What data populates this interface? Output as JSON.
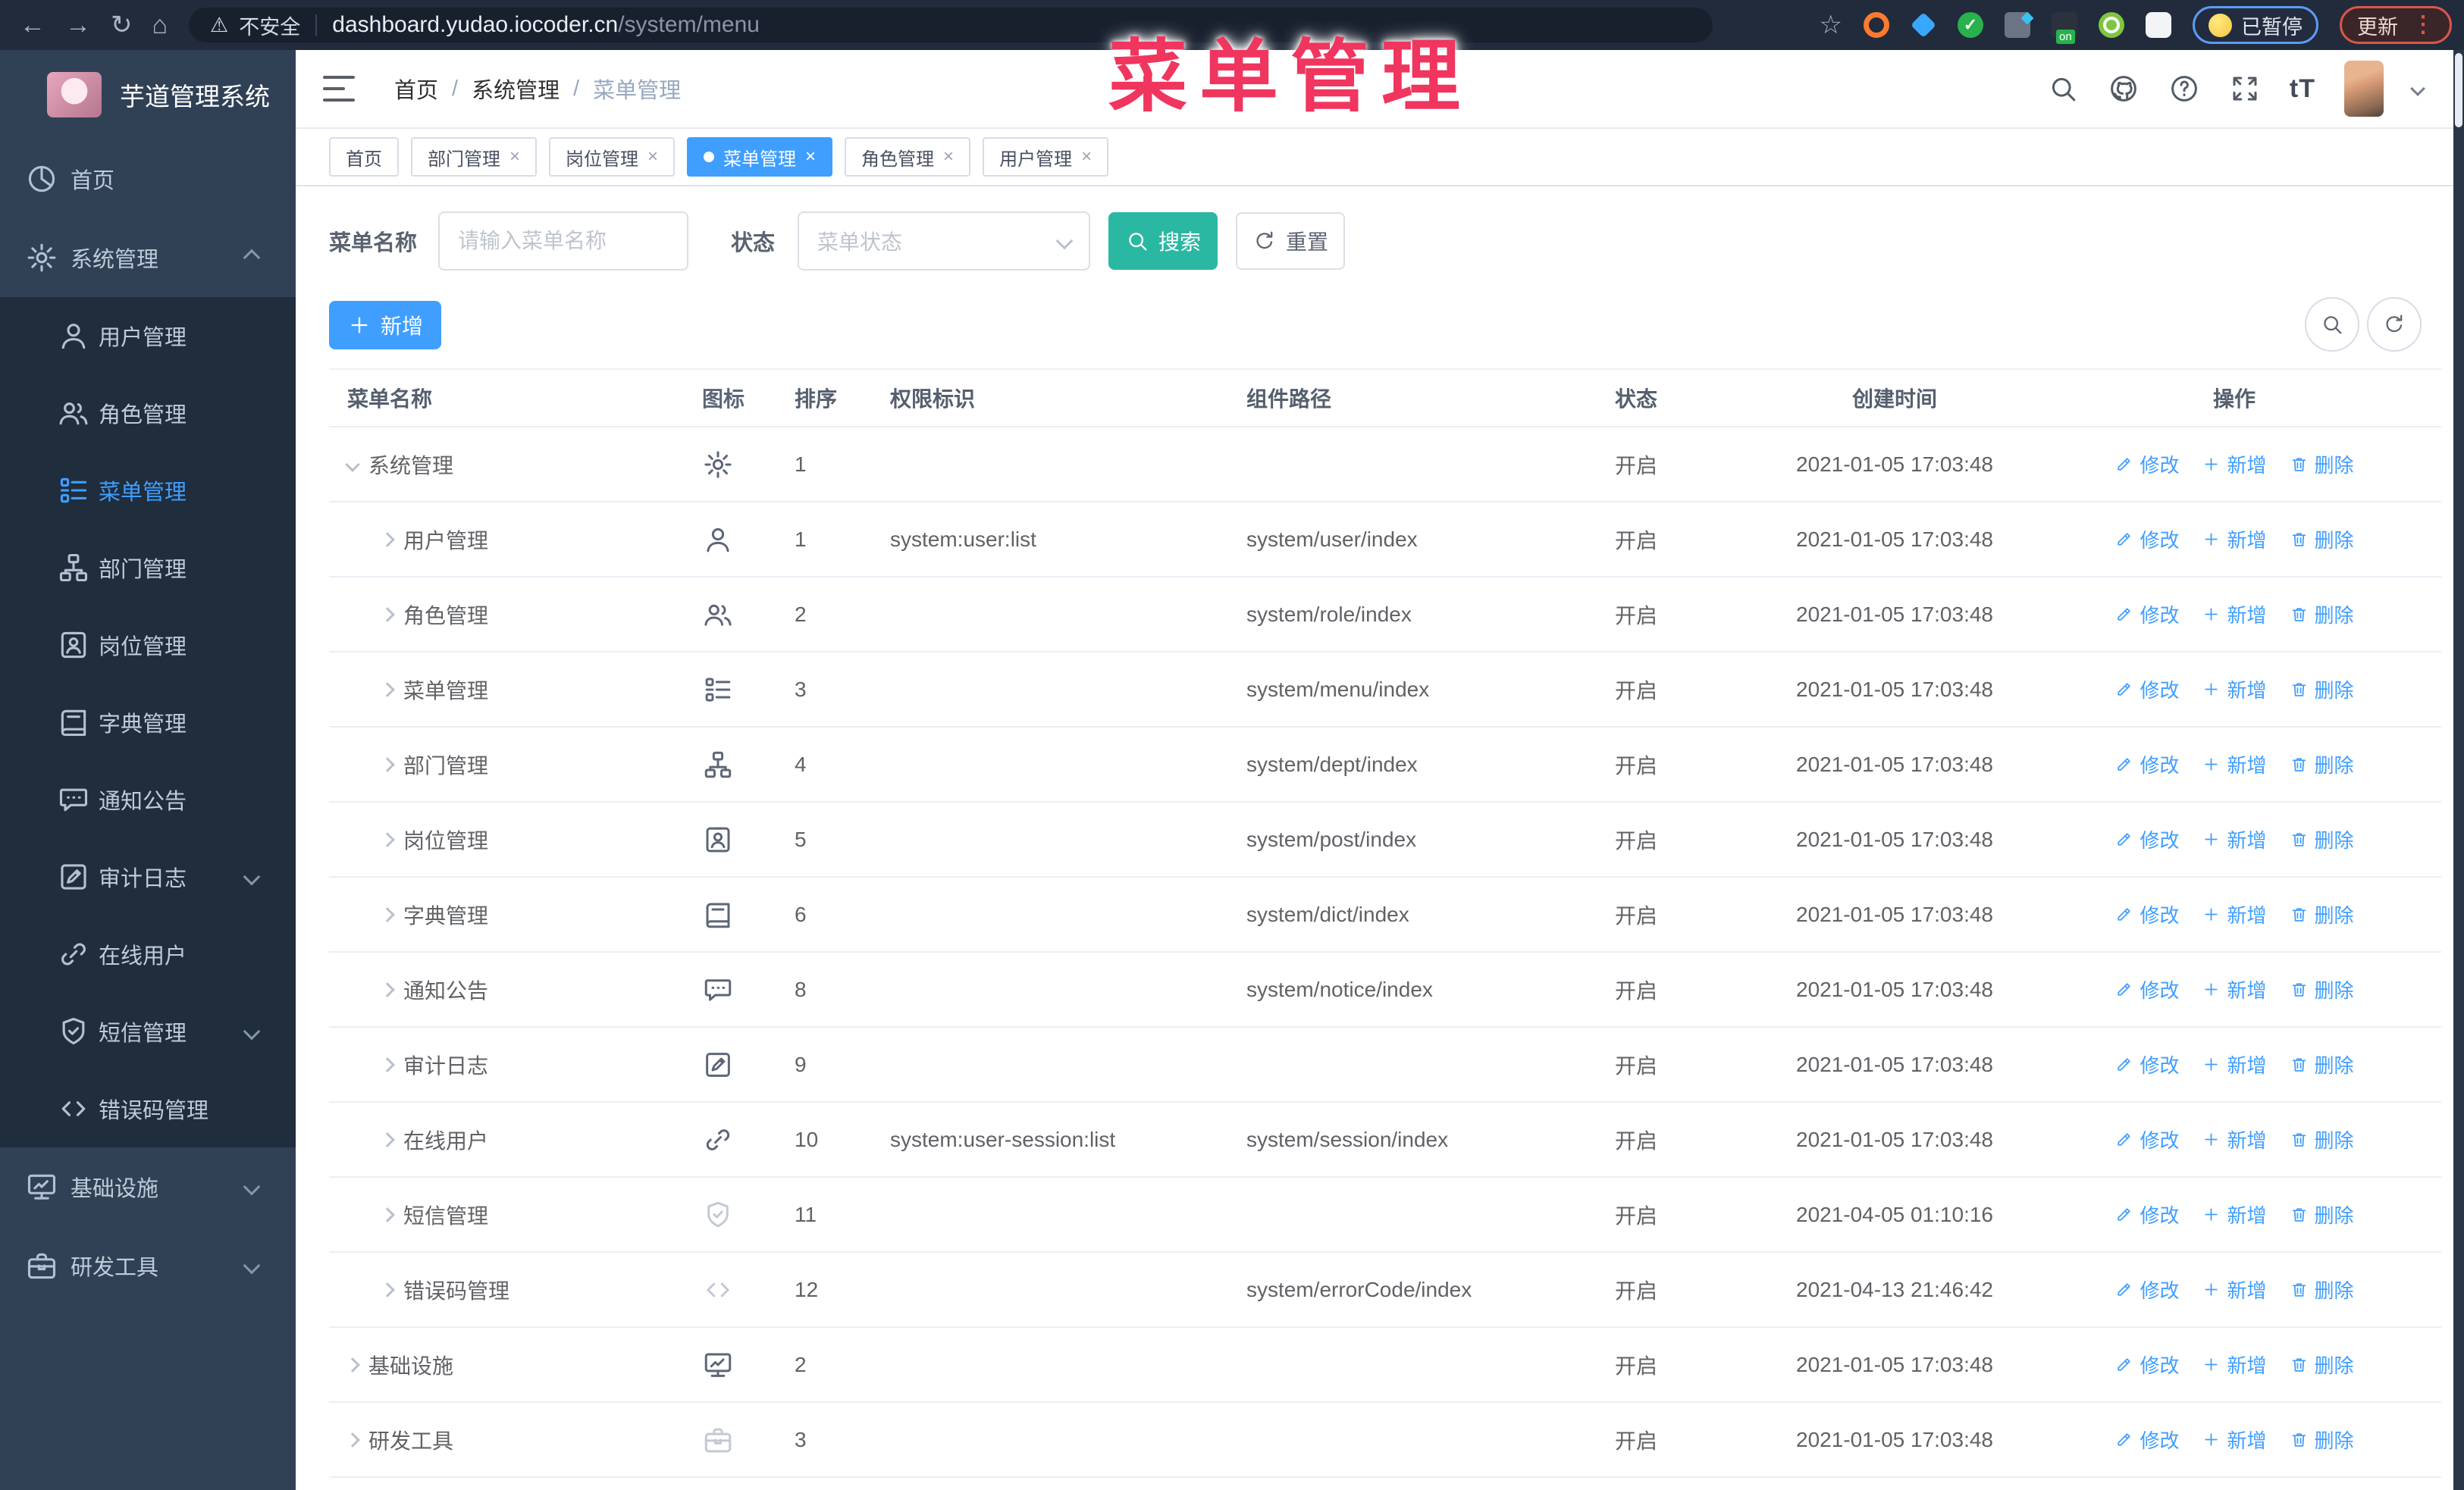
{
  "colors": {
    "primary": "#409eff",
    "search_button": "#2bb8a3",
    "annotation_pink": "#f0355e",
    "sidebar_bg": "#304156",
    "submenu_bg": "#1f2d3d"
  },
  "browser": {
    "insecure_label": "不安全",
    "url_host": "dashboard.yudao.iocoder.cn",
    "url_path": "/system/menu",
    "paused_badge": "已暂停",
    "update_label": "更新"
  },
  "annotation": {
    "text": "菜单管理"
  },
  "sidebar": {
    "app_title": "芋道管理系统",
    "items": [
      {
        "label": "首页",
        "icon": "dashboard",
        "level": 0
      },
      {
        "label": "系统管理",
        "icon": "gear",
        "level": 0,
        "caret": "up"
      },
      {
        "label": "用户管理",
        "icon": "user",
        "level": 1
      },
      {
        "label": "角色管理",
        "icon": "users",
        "level": 1
      },
      {
        "label": "菜单管理",
        "icon": "menu",
        "level": 1,
        "active": true
      },
      {
        "label": "部门管理",
        "icon": "tree",
        "level": 1
      },
      {
        "label": "岗位管理",
        "icon": "badge",
        "level": 1
      },
      {
        "label": "字典管理",
        "icon": "book",
        "level": 1
      },
      {
        "label": "通知公告",
        "icon": "message",
        "level": 1
      },
      {
        "label": "审计日志",
        "icon": "editlog",
        "level": 1,
        "caret": "down"
      },
      {
        "label": "在线用户",
        "icon": "link",
        "level": 1
      },
      {
        "label": "短信管理",
        "icon": "shield",
        "level": 1,
        "caret": "down"
      },
      {
        "label": "错误码管理",
        "icon": "code",
        "level": 1
      },
      {
        "label": "基础设施",
        "icon": "monitor",
        "level": 0,
        "caret": "down"
      },
      {
        "label": "研发工具",
        "icon": "toolbox",
        "level": 0,
        "caret": "down"
      }
    ]
  },
  "header": {
    "breadcrumbs": [
      "首页",
      "系统管理",
      "菜单管理"
    ],
    "separator": "/"
  },
  "tabs": [
    {
      "label": "首页",
      "active": false,
      "closable": false
    },
    {
      "label": "部门管理",
      "active": false,
      "closable": true
    },
    {
      "label": "岗位管理",
      "active": false,
      "closable": true
    },
    {
      "label": "菜单管理",
      "active": true,
      "closable": true
    },
    {
      "label": "角色管理",
      "active": false,
      "closable": true
    },
    {
      "label": "用户管理",
      "active": false,
      "closable": true
    }
  ],
  "filters": {
    "name_label": "菜单名称",
    "name_placeholder": "请输入菜单名称",
    "status_label": "状态",
    "status_placeholder": "菜单状态",
    "search_label": "搜索",
    "reset_label": "重置"
  },
  "toolbar": {
    "add_label": "新增"
  },
  "table": {
    "columns": [
      "菜单名称",
      "图标",
      "排序",
      "权限标识",
      "组件路径",
      "状态",
      "创建时间",
      "操作"
    ],
    "row_actions": {
      "edit": "修改",
      "add": "新增",
      "delete": "删除"
    },
    "rows": [
      {
        "name": "系统管理",
        "icon": "gear",
        "level": 0,
        "caret": "down",
        "sort": "1",
        "perm": "",
        "path": "",
        "status": "开启",
        "created": "2021-01-05 17:03:48"
      },
      {
        "name": "用户管理",
        "icon": "user",
        "level": 1,
        "caret": "right",
        "sort": "1",
        "perm": "system:user:list",
        "path": "system/user/index",
        "status": "开启",
        "created": "2021-01-05 17:03:48"
      },
      {
        "name": "角色管理",
        "icon": "users",
        "level": 1,
        "caret": "right",
        "sort": "2",
        "perm": "",
        "path": "system/role/index",
        "status": "开启",
        "created": "2021-01-05 17:03:48"
      },
      {
        "name": "菜单管理",
        "icon": "menu",
        "level": 1,
        "caret": "right",
        "sort": "3",
        "perm": "",
        "path": "system/menu/index",
        "status": "开启",
        "created": "2021-01-05 17:03:48"
      },
      {
        "name": "部门管理",
        "icon": "tree",
        "level": 1,
        "caret": "right",
        "sort": "4",
        "perm": "",
        "path": "system/dept/index",
        "status": "开启",
        "created": "2021-01-05 17:03:48"
      },
      {
        "name": "岗位管理",
        "icon": "badge",
        "level": 1,
        "caret": "right",
        "sort": "5",
        "perm": "",
        "path": "system/post/index",
        "status": "开启",
        "created": "2021-01-05 17:03:48"
      },
      {
        "name": "字典管理",
        "icon": "book",
        "level": 1,
        "caret": "right",
        "sort": "6",
        "perm": "",
        "path": "system/dict/index",
        "status": "开启",
        "created": "2021-01-05 17:03:48"
      },
      {
        "name": "通知公告",
        "icon": "message",
        "level": 1,
        "caret": "right",
        "sort": "8",
        "perm": "",
        "path": "system/notice/index",
        "status": "开启",
        "created": "2021-01-05 17:03:48"
      },
      {
        "name": "审计日志",
        "icon": "editlog",
        "level": 1,
        "caret": "right",
        "sort": "9",
        "perm": "",
        "path": "",
        "status": "开启",
        "created": "2021-01-05 17:03:48"
      },
      {
        "name": "在线用户",
        "icon": "link",
        "level": 1,
        "caret": "right",
        "sort": "10",
        "perm": "system:user-session:list",
        "path": "system/session/index",
        "status": "开启",
        "created": "2021-01-05 17:03:48"
      },
      {
        "name": "短信管理",
        "icon": "shield",
        "level": 1,
        "caret": "right",
        "sort": "11",
        "perm": "",
        "path": "",
        "status": "开启",
        "created": "2021-04-05 01:10:16",
        "muted": true
      },
      {
        "name": "错误码管理",
        "icon": "code",
        "level": 1,
        "caret": "right",
        "sort": "12",
        "perm": "",
        "path": "system/errorCode/index",
        "status": "开启",
        "created": "2021-04-13 21:46:42",
        "muted": true
      },
      {
        "name": "基础设施",
        "icon": "monitor",
        "level": 0,
        "caret": "right",
        "sort": "2",
        "perm": "",
        "path": "",
        "status": "开启",
        "created": "2021-01-05 17:03:48"
      },
      {
        "name": "研发工具",
        "icon": "toolbox",
        "level": 0,
        "caret": "right",
        "sort": "3",
        "perm": "",
        "path": "",
        "status": "开启",
        "created": "2021-01-05 17:03:48",
        "muted": true
      }
    ]
  }
}
